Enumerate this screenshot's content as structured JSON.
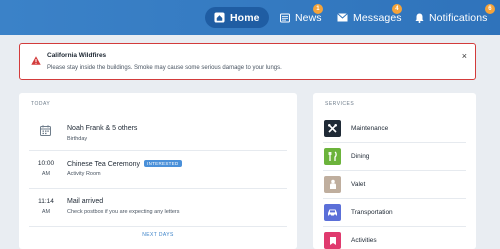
{
  "nav": {
    "home": {
      "label": "Home"
    },
    "news": {
      "label": "News",
      "badge": "1"
    },
    "messages": {
      "label": "Messages",
      "badge": "4"
    },
    "notifications": {
      "label": "Notifications",
      "badge": "6"
    }
  },
  "alert": {
    "title": "California Wildfires",
    "message": "Please stay inside the buildings. Smoke may cause some serious damage to your lungs.",
    "close": "×",
    "color": "#d33b3b"
  },
  "today": {
    "label": "TODAY",
    "events": [
      {
        "time": "",
        "ampm": "",
        "title": "Noah Frank & 5 others",
        "subtitle": "Birthday",
        "icon": "calendar-icon"
      },
      {
        "time": "10:00",
        "ampm": "AM",
        "title": "Chinese Tea Ceremony",
        "tag": "INTERESTED",
        "subtitle": "Activity Room"
      },
      {
        "time": "11:14",
        "ampm": "AM",
        "title": "Mail arrived",
        "subtitle": "Check postbox if you are expecting any letters"
      }
    ],
    "next": "NEXT DAYS"
  },
  "services": {
    "label": "SERVICES",
    "items": [
      {
        "label": "Maintenance",
        "icon": "tools-icon",
        "color": "#1f2a36"
      },
      {
        "label": "Dining",
        "icon": "dining-icon",
        "color": "#6bb33b"
      },
      {
        "label": "Valet",
        "icon": "valet-icon",
        "color": "#bfae9e"
      },
      {
        "label": "Transportation",
        "icon": "car-icon",
        "color": "#5b6fd8"
      },
      {
        "label": "Activities",
        "icon": "activities-icon",
        "color": "#e03a6e"
      }
    ]
  },
  "colors": {
    "nav_bg": "#3b82c8",
    "nav_active": "#1f5da3",
    "badge": "#f5a33a",
    "tag": "#4a90d9"
  }
}
